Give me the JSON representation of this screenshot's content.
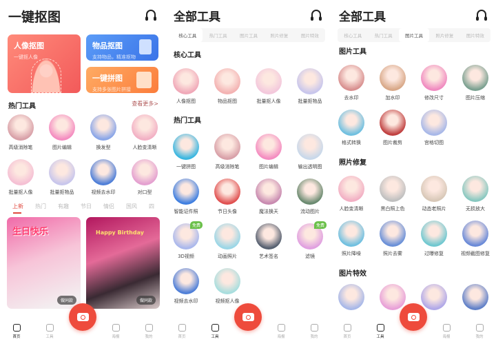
{
  "colors": {
    "accent": "#ee4b3c",
    "portrait": "#f25a5a",
    "object": "#3b74e8",
    "collage": "#fb7d3c",
    "free_badge": "#6bc04a"
  },
  "home": {
    "title": "一键抠图",
    "cards": [
      {
        "title": "人像抠图",
        "subtitle": "一键抠人像"
      },
      {
        "title": "物品抠图",
        "subtitle": "支持物品，精准抠物"
      },
      {
        "title": "一键拼图",
        "subtitle": "支持多张图片拼接"
      }
    ],
    "hot_title": "热门工具",
    "more": "查看更多>",
    "tools": [
      [
        "高级消除笔",
        "#d8a0a8"
      ],
      [
        "图片编辑",
        "#f48cc0"
      ],
      [
        "换发型",
        "#8aa6e8"
      ],
      [
        "人脸变清晰",
        "#f2b0c4"
      ],
      [
        "批量抠人像",
        "#f5c0d4"
      ],
      [
        "批量抠物品",
        "#c8c6ec"
      ],
      [
        "视频去水印",
        "#4f7fd8"
      ],
      [
        "对口型",
        "#e4a0d0"
      ]
    ],
    "feed_tabs": [
      "上新",
      "热门",
      "有趣",
      "节日",
      "情侣",
      "国风",
      "四"
    ],
    "posters": [
      {
        "text": "生日快乐",
        "button": "做同款"
      },
      {
        "text": "Happy Birthday",
        "button": "做同款"
      }
    ]
  },
  "all_tools": {
    "title": "全部工具",
    "tabs": [
      "核心工具",
      "热门工具",
      "图片工具",
      "照片修复",
      "图片特效"
    ],
    "core_title": "核心工具",
    "core": [
      [
        "人像抠图",
        "#f0a8b8"
      ],
      [
        "物品抠图",
        "#f3b2b2"
      ],
      [
        "批量抠人像",
        "#f3c8dc"
      ],
      [
        "批量抠物品",
        "#c8c6ec"
      ]
    ],
    "hot_title": "热门工具",
    "hot": [
      [
        "一键拼图",
        "#3ab6e0",
        ""
      ],
      [
        "高级消除笔",
        "#d8a0a8",
        ""
      ],
      [
        "图片编辑",
        "#f48cc0",
        ""
      ],
      [
        "输出透明图",
        "#c8d8ea",
        ""
      ],
      [
        "智能证件照",
        "#3f7fe0",
        ""
      ],
      [
        "节日头像",
        "#e05050",
        ""
      ],
      [
        "魔法换天",
        "#c88ab0",
        ""
      ],
      [
        "流动图片",
        "#6a8a70",
        ""
      ],
      [
        "3D视频",
        "#aab8ec",
        "免费"
      ],
      [
        "动画照片",
        "#9ad6e6",
        ""
      ],
      [
        "艺术签名",
        "#566070",
        ""
      ],
      [
        "滤镜",
        "#e0a0e0",
        "免费"
      ],
      [
        "视频去水印",
        "#4f7fd8",
        ""
      ],
      [
        "视频抠人像",
        "#a8dede",
        ""
      ]
    ],
    "badge": "免费"
  },
  "image_tools": {
    "title": "全部工具",
    "tabs": [
      "核心工具",
      "热门工具",
      "图片工具",
      "照片修复",
      "图片特效"
    ],
    "sections": [
      {
        "title": "图片工具",
        "items": [
          [
            "去水印",
            "#d89090"
          ],
          [
            "加水印",
            "#d8a888"
          ],
          [
            "修改尺寸",
            "#f08ac0"
          ],
          [
            "图片压缩",
            "#7aa090"
          ],
          [
            "格式转换",
            "#70c0e0"
          ],
          [
            "图片裁剪",
            "#c04040"
          ],
          [
            "宫格切图",
            "#a8b8e8"
          ]
        ]
      },
      {
        "title": "照片修复",
        "items": [
          [
            "人脸变清晰",
            "#f2b0c4"
          ],
          [
            "黑白照上色",
            "#c0c0c0"
          ],
          [
            "动态老照片",
            "#d8c8b8"
          ],
          [
            "无损放大",
            "#88c8c0"
          ],
          [
            "照片降噪",
            "#70c0e0"
          ],
          [
            "照片去雾",
            "#6a90d8"
          ],
          [
            "过曝修复",
            "#70c8d0"
          ],
          [
            "视频截图修复",
            "#6a8ad8"
          ]
        ]
      },
      {
        "title": "图片特效",
        "items": [
          [
            "",
            "#a8b8e8"
          ],
          [
            "",
            "#e8a0d8"
          ],
          [
            "",
            "#b0a8e8"
          ],
          [
            "",
            "#6080c8"
          ]
        ]
      }
    ]
  },
  "nav": [
    "首页",
    "工具",
    "海报",
    "我的"
  ]
}
